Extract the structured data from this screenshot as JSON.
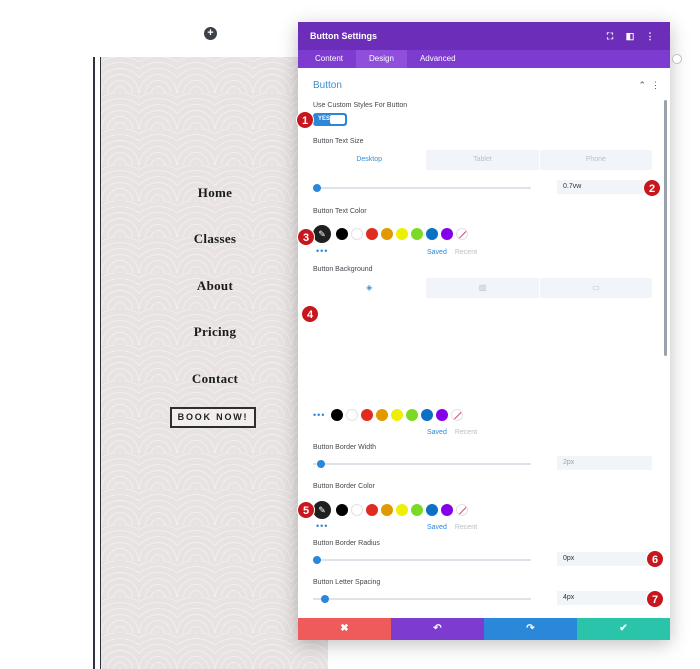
{
  "add_icon": "plus-icon",
  "preview": {
    "nav": [
      "Home",
      "Classes",
      "About",
      "Pricing",
      "Contact"
    ],
    "cta": "BOOK NOW!"
  },
  "modal": {
    "title": "Button Settings",
    "header_icons": [
      "fullscreen-icon",
      "sidebar-icon",
      "more-icon"
    ],
    "tabs": [
      "Content",
      "Design",
      "Advanced"
    ],
    "active_tab": "Design",
    "section": "Button",
    "fields": {
      "custom_styles_label": "Use Custom Styles For Button",
      "toggle_value": "YES",
      "text_size_label": "Button Text Size",
      "devices": [
        "Desktop",
        "Tablet",
        "Phone"
      ],
      "text_size_value": "0.7vw",
      "text_color_label": "Button Text Color",
      "background_label": "Button Background",
      "border_width_label": "Button Border Width",
      "border_width_value": "2px",
      "border_color_label": "Button Border Color",
      "border_radius_label": "Button Border Radius",
      "border_radius_value": "0px",
      "letter_spacing_label": "Button Letter Spacing",
      "letter_spacing_value": "4px",
      "saved": "Saved",
      "recent": "Recent"
    },
    "palette": [
      "#000000",
      "#ffffff",
      "#e02b20",
      "#e09900",
      "#edf000",
      "#7cda24",
      "#0c71c3",
      "#8300e9"
    ],
    "slider_levels": {
      "text_size": 0.0,
      "border_width": 0.02,
      "border_radius": 0.0,
      "letter_spacing": 0.04
    }
  },
  "footer": {
    "cancel": "✖",
    "undo": "↶",
    "redo": "↷",
    "save": "✔"
  },
  "badges": [
    "1",
    "2",
    "3",
    "4",
    "5",
    "6",
    "7"
  ]
}
